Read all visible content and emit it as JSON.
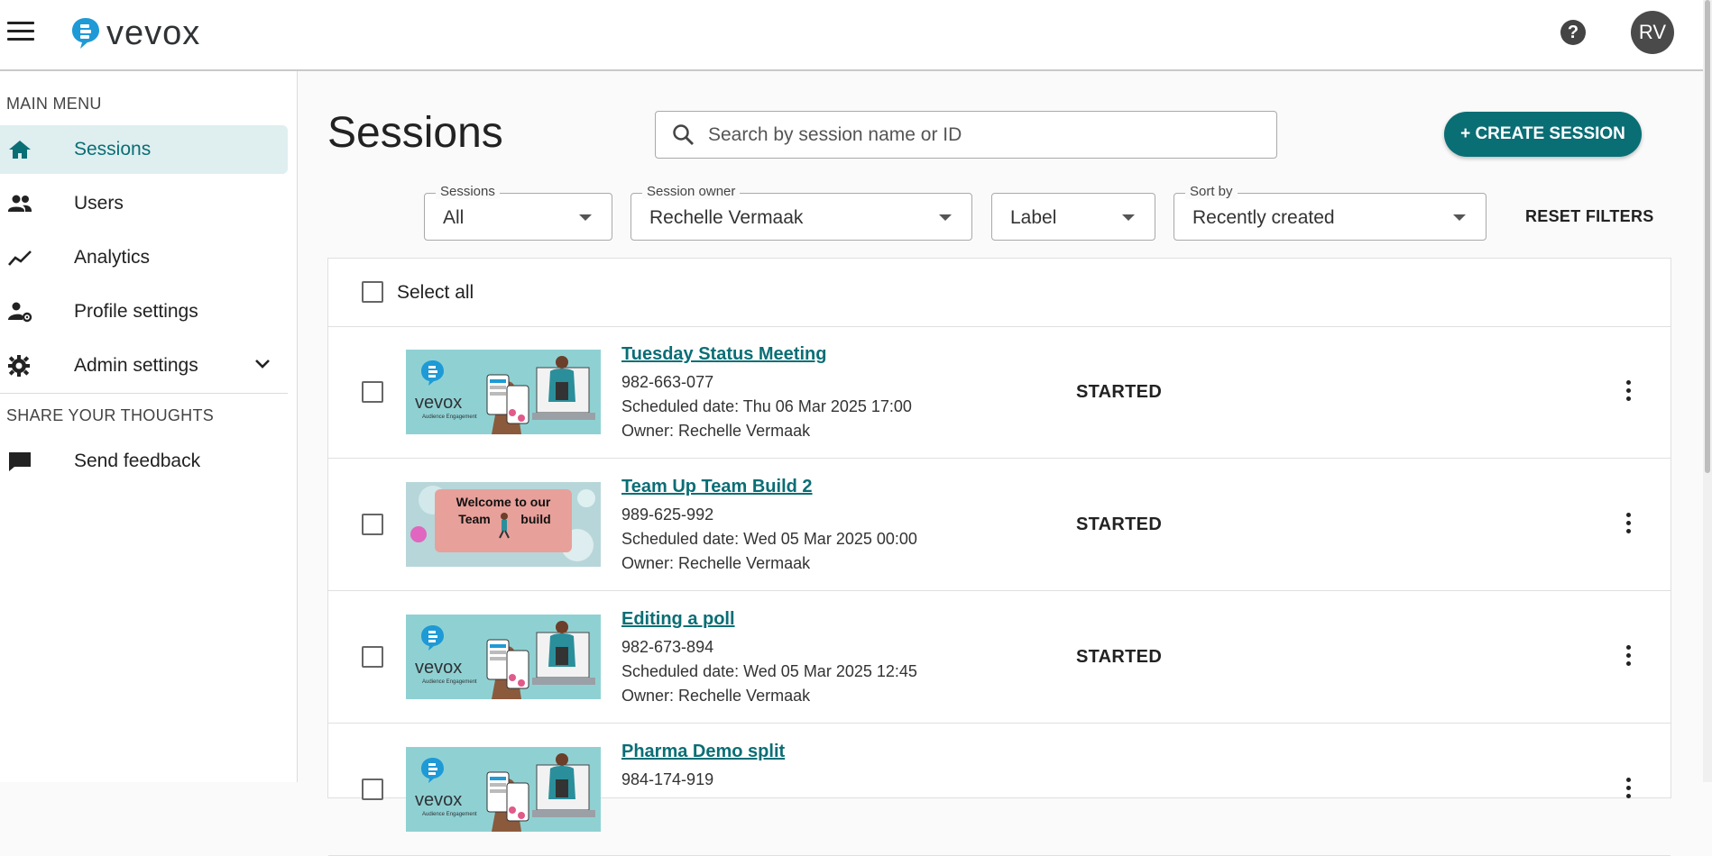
{
  "header": {
    "logo_text": "vevox",
    "help_glyph": "?",
    "avatar_initials": "RV"
  },
  "search": {
    "placeholder": "Search by session name or ID"
  },
  "sidebar": {
    "main_menu_title": "MAIN MENU",
    "items": [
      {
        "label": "Sessions",
        "icon": "home-icon"
      },
      {
        "label": "Users",
        "icon": "users-icon"
      },
      {
        "label": "Analytics",
        "icon": "analytics-icon"
      },
      {
        "label": "Profile settings",
        "icon": "profile-settings-icon"
      },
      {
        "label": "Admin settings",
        "icon": "gear-icon"
      }
    ],
    "feedback_title": "SHARE YOUR THOUGHTS",
    "feedback_item": {
      "label": "Send feedback",
      "icon": "chat-bubble-icon"
    }
  },
  "main": {
    "title": "Sessions",
    "create_button": "+ CREATE SESSION",
    "filters": [
      {
        "label": "Sessions",
        "value": "All"
      },
      {
        "label": "Session owner",
        "value": "Rechelle Vermaak"
      },
      {
        "label": "",
        "value": "Label"
      },
      {
        "label": "Sort by",
        "value": "Recently created"
      }
    ],
    "reset_filters": "RESET FILTERS",
    "select_all": "Select all",
    "sessions": [
      {
        "title": "Tuesday Status Meeting",
        "id": "982-663-077",
        "scheduled": "Scheduled date: Thu 06 Mar 2025 17:00",
        "owner": "Owner: Rechelle Vermaak",
        "status": "STARTED",
        "thumbnail": "vevox-banner"
      },
      {
        "title": "Team Up Team Build 2",
        "id": "989-625-992",
        "scheduled": "Scheduled date: Wed 05 Mar 2025 00:00",
        "owner": "Owner: Rechelle Vermaak",
        "status": "STARTED",
        "thumbnail": "team-build-banner",
        "thumbnail_text": [
          "Welcome to our",
          "Team",
          "build"
        ]
      },
      {
        "title": "Editing a poll",
        "id": "982-673-894",
        "scheduled": "Scheduled date: Wed 05 Mar 2025 12:45",
        "owner": "Owner: Rechelle Vermaak",
        "status": "STARTED",
        "thumbnail": "vevox-banner"
      },
      {
        "title": "Pharma Demo split",
        "id": "984-174-919",
        "scheduled": "",
        "owner": "",
        "status": "",
        "thumbnail": "vevox-banner"
      }
    ]
  },
  "thumb_logo_text": "vevox",
  "thumb_sub_text": "Audience Engagement",
  "colors": {
    "accent": "#0a6e75",
    "active_bg": "#dfeeef",
    "thumb_bg": "#8fd1d3"
  }
}
